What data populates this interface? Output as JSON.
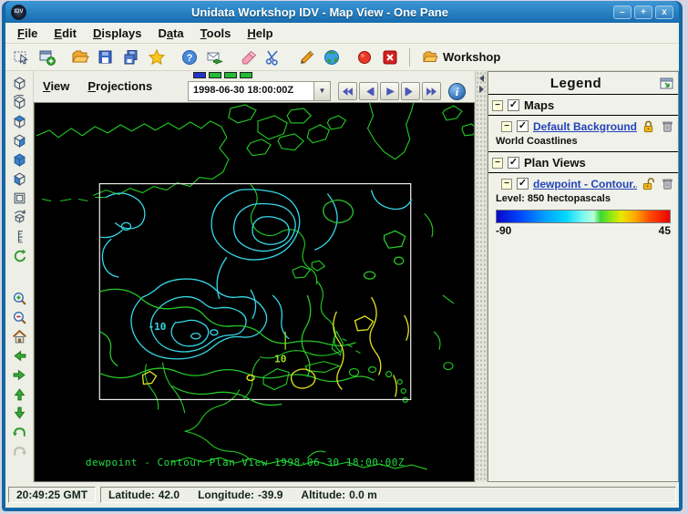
{
  "colors": {
    "coastline": "#22cc22",
    "contour_cyan": "#35d8e8",
    "contour_green": "#28c828",
    "contour_lime": "#9ade22",
    "contour_yellow": "#e2e222",
    "annotation": "#22dd44",
    "data_box": "#eeeeee",
    "link": "#2244bb",
    "nav_glyph": "#4a55b8"
  },
  "glyphs": {
    "check": "✓",
    "collapse": "−",
    "dropdown": "▼",
    "help": "?",
    "info": "i"
  },
  "window": {
    "title": "Unidata Workshop IDV - Map View - One Pane",
    "icon": "IDV",
    "minimize": "–",
    "maximize": "+",
    "close": "x"
  },
  "menus": [
    {
      "pre": "",
      "key": "F",
      "post": "ile"
    },
    {
      "pre": "",
      "key": "E",
      "post": "dit"
    },
    {
      "pre": "",
      "key": "D",
      "post": "isplays"
    },
    {
      "pre": "D",
      "key": "a",
      "post": "ta"
    },
    {
      "pre": "",
      "key": "T",
      "post": "ools"
    },
    {
      "pre": "",
      "key": "H",
      "post": "elp"
    }
  ],
  "view_menus": [
    {
      "pre": "",
      "key": "V",
      "post": "iew"
    },
    {
      "pre": "",
      "key": "P",
      "post": "rojections"
    }
  ],
  "toolbar": {
    "icons": [
      "select-display",
      "new-display-window",
      "open-file",
      "save",
      "copy-display",
      "favorites",
      "help",
      "support-request",
      "erase-displays",
      "cut-remove-displays",
      "edit-preferences",
      "show-data-choosers",
      "capture-image",
      "exit"
    ],
    "workshop": "Workshop"
  },
  "leftbar": {
    "icons": [
      "perspective-view",
      "rotate-view",
      "top-view",
      "right-view",
      "front-view",
      "bottom-view",
      "reset-projection",
      "auto-rotate",
      "vertical-scale",
      "reset-rotation",
      "zoom-in",
      "zoom-out",
      "home-view",
      "pan-left",
      "pan-right",
      "pan-up",
      "pan-down",
      "undo",
      "redo"
    ]
  },
  "time_control": {
    "value": "1998-06-30 18:00:00Z",
    "step_colors": [
      "#2233cc",
      "#22bb33",
      "#22bb33",
      "#22bb33"
    ],
    "buttons": [
      "rewind",
      "step-back",
      "play",
      "step-forward",
      "fast-forward"
    ]
  },
  "map": {
    "annotation": "dewpoint - Contour Plan View 1998-06-30 18:00:00Z",
    "labels": {
      "low": "-10",
      "high": "10"
    }
  },
  "legend": {
    "title": "Legend",
    "maps_group": "Maps",
    "map_item": {
      "link": "Default Background ...",
      "sub": "World Coastlines"
    },
    "plan_group": "Plan Views",
    "plan_item": {
      "link": "dewpoint - Contour...",
      "level": "Level: 850 hectopascals",
      "range_min": "-90",
      "range_max": "45",
      "colorbar_stops": [
        {
          "pos": "0%",
          "color": "#0a08c8"
        },
        {
          "pos": "14%",
          "color": "#0048ff"
        },
        {
          "pos": "28%",
          "color": "#00a0ff"
        },
        {
          "pos": "40%",
          "color": "#00d8ff"
        },
        {
          "pos": "50%",
          "color": "#7cf8ee"
        },
        {
          "pos": "56%",
          "color": "#b8ffd8"
        },
        {
          "pos": "60%",
          "color": "#38d838"
        },
        {
          "pos": "66%",
          "color": "#90e810"
        },
        {
          "pos": "72%",
          "color": "#e8e800"
        },
        {
          "pos": "80%",
          "color": "#ffa800"
        },
        {
          "pos": "88%",
          "color": "#ff5000"
        },
        {
          "pos": "100%",
          "color": "#f00000"
        }
      ]
    }
  },
  "status": {
    "clock": "20:49:25 GMT",
    "lat_label": "Latitude:",
    "lat": "42.0",
    "lon_label": "Longitude:",
    "lon": "-39.9",
    "alt_label": "Altitude:",
    "alt": "0.0 m"
  }
}
